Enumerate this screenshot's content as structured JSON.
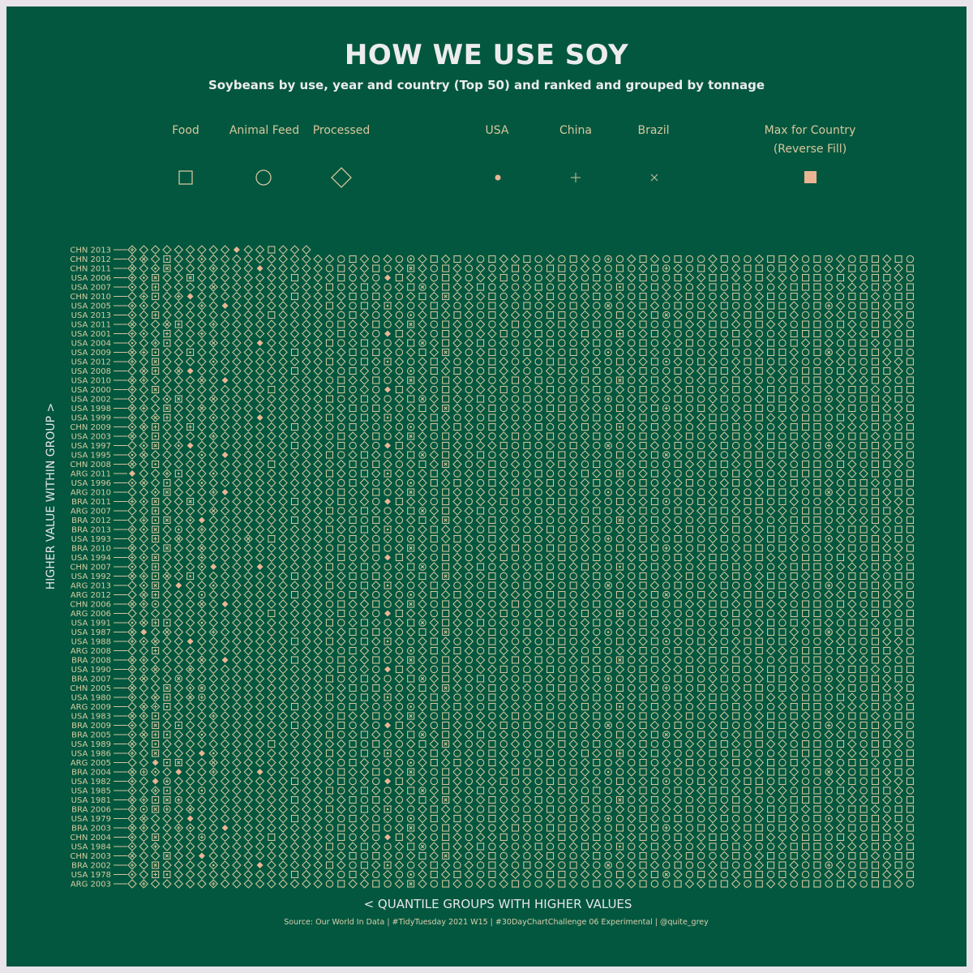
{
  "colors": {
    "background": "#03573f",
    "frame": "#e8e4ea",
    "symbol": "#cfc49c",
    "highlight": "#eab593",
    "text": "#d8c79c"
  },
  "title": "HOW WE USE SOY",
  "subtitle": "Soybeans by use, year and country (Top 50) and ranked and grouped by tonnage",
  "legend": [
    {
      "label": "Food",
      "symbol": "square"
    },
    {
      "label": "Animal Feed",
      "symbol": "circle"
    },
    {
      "label": "Processed",
      "symbol": "diamond"
    },
    {
      "label": "USA",
      "symbol": "dot"
    },
    {
      "label": "China",
      "symbol": "plus"
    },
    {
      "label": "Brazil",
      "symbol": "cross"
    },
    {
      "label": "Max for Country",
      "label2": "(Reverse Fill)",
      "symbol": "filled-square"
    }
  ],
  "x_axis_label": "< QUANTILE GROUPS WITH HIGHER VALUES",
  "y_axis_label": "HIGHER VALUE WITHIN GROUP >",
  "source": "Source: Our World In Data  |  #TidyTuesday 2021 W15  |  #30DayChartChallenge 06 Experimental  |  @quite_grey",
  "chart_data": {
    "type": "table",
    "title": "HOW WE USE SOY",
    "xlabel": "< QUANTILE GROUPS WITH HIGHER VALUES",
    "ylabel": "HIGHER VALUE WITHIN GROUP >",
    "symbol_key": {
      "D": "Processed",
      "O": "Animal Feed",
      "S": "Food",
      "lowercase": "with country marker",
      "*": "Max for Country"
    },
    "rows": [
      {
        "label": "CHN 2013",
        "cells": "dDDDDDDDD*DDSDDD"
      },
      {
        "label": "CHN 2012",
        "cells": "ddDsDDdDDDDDDDDDDDOSDODOoDSDSDOSDDSODOSDOoODSDOSOODSOODSSDOSoDOSSDSO"
      },
      {
        "label": "CHN 2011",
        "cells": "dDdsDDDdDDD*DDDDDOSDDSODsDOSDODODSDOSSODDOSODSoDOSDODSSOSDOODDSOSDDS"
      },
      {
        "label": "USA 2006",
        "cells": "ddsDDsDDDDDDDDSDDDSODO*SDDOSDODDSOOODSDOSODDSOOSDDSSDOSDDOSSOSDOSSDO"
      },
      {
        "label": "USA 2007",
        "cells": "dDsDDDDdDDDDDDDDDSODSDODSoDSDDSODODSOODSDOsODSDOODSOSDOODSSSODDDSDOS"
      },
      {
        "label": "CHN 2010",
        "cells": "DdsDd*DDDDDDDDSDDDDSOSDODSDsDODSODODSOODSODOSODDSOODSODSOSDSDOSSDOSS"
      },
      {
        "label": "USA 2005",
        "cells": "ddDDDDdD*DDDDDDDDSDOSDsDODSDODOSDOSODOSDOoODSDOSOODSOODSSDOSoDOSSDSO"
      },
      {
        "label": "USA 2013",
        "cells": "dDsDDDDDDDDDSDDDDDOSDODOoDSDSDOSDDDOSSODDOSODSoDOSDODSSOSDOODDSOSDDS"
      },
      {
        "label": "USA 2011",
        "cells": "dDDdsDDdDDDDDDDDDOSDDSODsDOSDODODSOODSDOSODDSOOSDDSSDOSDDOSSOSDOSSDO"
      },
      {
        "label": "USA 2001",
        "cells": "ddDsDDdDDDDDDDDDDDSODO*SDDOSDODDSODSOODSDOsODSDOODSOSDOODSSSODDDSDOS"
      },
      {
        "label": "USA 2004",
        "cells": "dDdsDDDdDDD*DDDDDSODSDODSoDSDDSODOODSOODSODOSODDSOODSODSOSDSDOSSDOSS"
      },
      {
        "label": "USA 2009",
        "cells": "ddsDDsDDDDDDDDSDDDDSOSDODSDsDODSODSODOSDOoODSDOSOODSOODSSDOSoDOSSDSO"
      },
      {
        "label": "USA 2012",
        "cells": "dDsDDDDdDDDDDDDDDSDOSDsDODSDODOSDODOSSODDOSODSoDOSDODSSOSDOODDSOSDDS"
      },
      {
        "label": "USA 2008",
        "cells": "DdsDd*DDDDDDDDSDDDOSDODOoDSDSDOSDDOODSDOSODDSOOSDDSSDOSDDOSSOSDOSSDO"
      },
      {
        "label": "USA 2010",
        "cells": "ddDDDDdD*DDDDDDDDOSDDSODsDOSDODODSDSOODSDOsODSDOODSOSDOODSSSODDDSDOS"
      },
      {
        "label": "USA 2000",
        "cells": "dDsDDDDDDDDDSDDDDDSODO*SDDOSDODDSOODSOODSODOSODDSOODSODSOSDSDOSSDOSS"
      },
      {
        "label": "USA 2002",
        "cells": "dDDdsDDdDDDDDDDDDSODSDODSoDSDDSODOSODOSDOoODSDOSOODSOODSSDOSoDOSSDSO"
      },
      {
        "label": "USA 1998",
        "cells": "ddDsDDdDDDDDDDDDDDDSOSDODSDsDODSODDOSSODDOSODSoDOSDODSSOSDOODDSOSDDS"
      },
      {
        "label": "USA 1999",
        "cells": "dDdsDDDdDDD*DDDDDSDOSDsDODSDODOSDOOODSDOSODDSOOSDDSSDOSDDOSSOSDOSSDO"
      },
      {
        "label": "CHN 2009",
        "cells": "ddsDDsDDDDDDDDSDDDOSDODOoDSDSDOSDDDSOODSDOsODSDOODSOSDOODSSSODDDSDOS"
      },
      {
        "label": "USA 2003",
        "cells": "dDsDDDDdDDDDDDDDDOSDDSODsDOSDODODSODSOODSODOSODDSOODSODSOSDSDOSSDOSS"
      },
      {
        "label": "USA 1997",
        "cells": "DdsDd*DDDDDDDDSDDDSODO*SDDOSDODDSOSODOSDOoODSDOSOODSOODSSDOSoDOSSDSO"
      },
      {
        "label": "USA 1995",
        "cells": "ddDDDDdD*DDDDDDDDSODSDODSoDSDDSODODOSSODDOSODSoDOSDODSSOSDOODDSOSDDS"
      },
      {
        "label": "CHN 2008",
        "cells": "dDsDDDDDDDDDSDDDDDDSOSDODSDsDODSODOODSDOSODDSOOSDDSSDOSDDOSSOSDOSSDO"
      },
      {
        "label": "ARG 2011",
        "cells": "*DDdsDDdDDDDDDDDDSDOSDsDODSDODOSDODSOODSDOsODSDOODSOSDOODSSSODDDSDOS"
      },
      {
        "label": "USA 1996",
        "cells": "ddDsDDdDDDDDDDDDDDOSDODOoDSDSDOSDDODSOODSODOSODDSOODSODSOSDSDOSSDOSS"
      },
      {
        "label": "ARG 2010",
        "cells": "DDdsDDDd*DDDDDDDDOSDDSODsDOSDODODSSODOSDOoODSDOSOODSOODSSDOSoDOSSDSO"
      },
      {
        "label": "BRA 2011",
        "cells": "ddsDDsDDDDDDDDSDDDSODO*SDDOSDODDSODOSSODDOSODSoDOSDODSSOSDOODDSOSDDS"
      },
      {
        "label": "ARG 2007",
        "cells": "DDsDDDDdDDDDDDDDDSODSDODSoDSDDSODOOODSDOSODDSOOSDDSSDOSDDOSSOSDOSSDO"
      },
      {
        "label": "BRA 2012",
        "cells": "DdssDd*DDDDDDDSDDDDSOSDODSDsDODSODDSOODSDOsODSDOODSOSDOODSSSODDDSDOS"
      },
      {
        "label": "BRA 2013",
        "cells": "ddsDoDdDDDDDDDDDDSDOSDsDODSDODOSDOODSOODSODOSODDSOODSODSOSDSDOSSDOSS"
      },
      {
        "label": "USA 1993",
        "cells": "dDsDdDDDDDdDSDDDDDOSDODOoDSDSDOSDDSODOSDOoODSDOSOODSOODSSDOSoDOSSDSO"
      },
      {
        "label": "BRA 2010",
        "cells": "dDDsDDdDDDDDDDDDDOSDDSODsDOSDODODSDOSSODDOSODSoDOSDODSSOSDOODDSOSDDS"
      },
      {
        "label": "USA 1994",
        "cells": "ddsDDDdDDDDDDDDDDDSODO*SDDOSDODDSOOODSDOSODDSOOSDDSSDOSDDOSSOSDOSSDO"
      },
      {
        "label": "CHN 2007",
        "cells": "dDsDDDd*DDD*DDDDDSODSDODSoDSDDSODODSOODSDOsODSDOODSOSDOODSSSODDDSDOS"
      },
      {
        "label": "USA 1992",
        "cells": "ddsdDsDDDDDDDDSDDDDSOSDODSDsDODSODODSOODSODOSODDSOODSODSOSDSDOSSDOSS"
      },
      {
        "label": "ARG 2013",
        "cells": "DdsD*DDdDDDDDDDDDSDOSDsDODSDODOSDOSODOSDOoODSDOSOODSOODSSDOSoDOSSDSO"
      },
      {
        "label": "ARG 2012",
        "cells": "DdsDDDoDDDDDDDSDDDOSDODOoDSDSDOSDDDOSSODDOSODSoDOSDODSSOSDOODDSOSDDS"
      },
      {
        "label": "CHN 2006",
        "cells": "ddoDDDdD*DDDDDDDDOSDDSODsDOSDODODSOODSDOSODDSOOSDDSSDOSDDOSSOSDOSSDO"
      },
      {
        "label": "ARG 2006",
        "cells": "DDDDDDDDDDDDSDDDDDSODO*SDDOSDODDSODSOODSDOsODSDOODSOSDOODSSSODDDSDOS"
      },
      {
        "label": "USA 1991",
        "cells": "ddssDDdDDDDDDDDDDSODSDODSoDSDDSODOODSOODSODOSODDSOODSODSOSDSDOSSDOSS"
      },
      {
        "label": "USA 1987",
        "cells": "d*DdDDDdDDDDDDDDDDDSOSDODSDsDODSODSODOSDOoODSDOSOODSOODSSDOSoDOSSDSO"
      },
      {
        "label": "USA 1988",
        "cells": "dddDD*DDDDDDDDSDDSDOSDsDODSDODOSDODOSSODDOSODSoDOSDODSSOSDOODDSOSDDS"
      },
      {
        "label": "ARG 2008",
        "cells": "DDsDDDDDDDDDDDDDDDOSDODOoDSDSDOSDDOODSDOSODDSOOSDDSSDOSDDOSSOSDOSSDO"
      },
      {
        "label": "BRA 2008",
        "cells": "ddDDDDdD*DDDDDSDDOSDDSODsDOSDODODSDSOODSDOsODSDOODSOSDOODSSSODDDSDOS"
      },
      {
        "label": "USA 1990",
        "cells": "dddDDdDDDDDDDDDDDDSODO*SDDOSDODDSOODSOODSODOSODDSOODSODSOSDSDOSSDOSS"
      },
      {
        "label": "BRA 2007",
        "cells": "ddDDoDDDDDDDDDDDDSODSDODSoDSDDSODOSODOSDOoODSDOSOODSOODSSDOSoDOSSDSO"
      },
      {
        "label": "CHN 2005",
        "cells": "dDDsDdoDDDDDDDDDDDDSOSDODSDsDODSODDOSSODDOSODSoDOSDODSSOSDOODDSOSDDS"
      },
      {
        "label": "USA 1980",
        "cells": "dDdsDdoDDDDDDDDDDSDOSDsDODSDODOSDOOODSDOSODDSOOSDDSSDOSDDOSSOSDOSSDO"
      },
      {
        "label": "ARG 2009",
        "cells": "DddsDDDDDDDDDDSDDDOSDODOoDSDSDOSDDDSOODSDOsODSDOODSOSDOODSSSODDDSDOS"
      },
      {
        "label": "USA 1983",
        "cells": "ddsDDDDdDDDDDDDDDOSDDSODsDOSDODODSODSOODSODOSODDSOODSODSOSDSDOSSDOSS"
      },
      {
        "label": "BRA 2009",
        "cells": "dDsDsDDDDDDDDDSDDDSODO*SDDOSDODDSOSODOSDOoODSDOSOODSOODSSDOSoDOSSDSO"
      },
      {
        "label": "BRA 2005",
        "cells": "ddssDDdDDDDDDDDDDSODSDODSoDSDDSODODOSSODDOSODSoDOSDODSSOSDOODDSOSDDS"
      },
      {
        "label": "USA 1989",
        "cells": "dDsDDDDDDDDDSDDDDDDSOSDODSDsDODSODOODSDOSODDSOOSDDSSDOSDDOSSOSDOSSDO"
      },
      {
        "label": "USA 1986",
        "cells": "dDsDDD*dDDDDDDDDDSDOSDsDODSDODOSDODSOODSDOsODSDOODSOSDOODSSSODDDSDOS"
      },
      {
        "label": "ARG 2005",
        "cells": "DD*ssDDdDDDDDDDDDDOSDODOoDSDSDOSDDODSOODSODOSODDSOODSODSOSDSDOSSDOSS"
      },
      {
        "label": "BRA 2004",
        "cells": "dodD*DDdDDD*DDDDDOSDDSODsDOSDODODSSODOSDOoODSDOSOODSOODSSDOSoDOSSDSO"
      },
      {
        "label": "USA 1982",
        "cells": "dD*oDDDDDDDDDDSDDDSODO*SDDOSDODDSODOSSODDOSODSoDOSDODSSOSDOODDSOSDDS"
      },
      {
        "label": "USA 1985",
        "cells": "dDdsDDoDDDDDDDDDDSODSDODSoDSDDSODOOODSDOSODDSOOSDDSSDOSDDOSSOSDOSSDO"
      },
      {
        "label": "USA 1981",
        "cells": "ddssoDDDDDDDDDSDDDDSOSDODSDsDODSODDSOODSDOsODSDOODSOSDOODSSSODDDSDOS"
      },
      {
        "label": "BRA 2006",
        "cells": "dosoDdDDDDDDDDDDDSDOSDsDODSDODOSDOODSOODSODOSODDSOODSODSOSDSDOSSDOSS"
      },
      {
        "label": "USA 1979",
        "cells": "ddDDD*DDDDDDDDSDDDOSDODOoDSDSDOSDDSODOSDOoODSDOSOODSOODSSDOSoDOSSDSO"
      },
      {
        "label": "BRA 2003",
        "cells": "ddDDddDD*DDDDDDDDOSDDSODsDOSDODODSDOSSODDOSODSoDOSDODSSOSDOODDSOSDDS"
      },
      {
        "label": "CHN 2004",
        "cells": "dDsDDDoDDDDDSDDDDDSODO*SDDOSDODDSOOODSDOSODDSOOSDDSSDOSDDOSSOSDOSSDO"
      },
      {
        "label": "USA 1984",
        "cells": "dDdDDDDDDDDDDDDDDSODSDODSoDSDDSODODSOODSDOsODSDOODSOSDOODSSSODDDSDOS"
      },
      {
        "label": "CHN 2003",
        "cells": "dDDsDD*DDDDDDDDDDDDSOSDODSDsDODSODODSOODSODOSODDSOODSODSOSDSDOSSDOSS"
      },
      {
        "label": "BRA 2002",
        "cells": "dDsDDDDdDDD*DDDDDSDOSDsDODSDODOSDOSODOSDOoODSDOSOODSOODSSDOSoDOSSDSO"
      },
      {
        "label": "USA 1978",
        "cells": "dDssDDDDDDDDDDSDDDOSDODOoDSDSDOSDDDOSSODDOSODSoDOSDODSSOSDOODDSOSDDS"
      },
      {
        "label": "ARG 2003",
        "cells": "DdDDDDDdDDDDDDDDDOSDDSODsDOSDODODSOODSDOSODDSOOSDDSSDOSDDOSSOSDOSSDO"
      }
    ]
  }
}
